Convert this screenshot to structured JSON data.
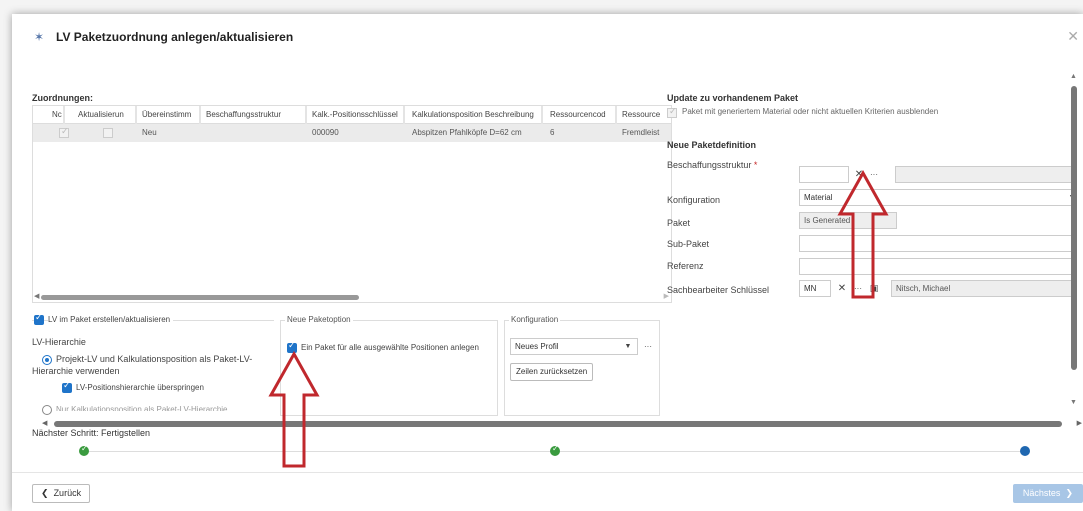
{
  "dialog": {
    "title": "LV Paketzuordnung anlegen/aktualisieren",
    "title_icon": "wand-icon",
    "close_icon": "close-icon"
  },
  "assignments": {
    "label": "Zuordnungen:",
    "columns": [
      "Nc",
      "Aktualisierun",
      "Übereinstimm",
      "Beschaffungsstruktur",
      "Kalk.-Positionsschlüssel",
      "Kalkulationsposition Beschreibung",
      "Ressourcencod",
      "Ressource"
    ],
    "rows": [
      {
        "nc_checked": true,
        "update_checked": false,
        "match": "Neu",
        "procurement": "",
        "calc_key": "000090",
        "calc_desc": "Abspitzen Pfahlköpfe D=62 cm",
        "resource_code": "6",
        "resource": "Fremdleist"
      }
    ]
  },
  "update_pane": {
    "title": "Update zu vorhandenem Paket",
    "hide_label": "Paket mit generiertem Material oder nicht aktuellen Kriterien ausblenden",
    "hide_checked": true
  },
  "new_package": {
    "title": "Neue Paketdefinition",
    "procurement_label": "Beschaffungsstruktur",
    "required_mark": "*",
    "configuration_label": "Konfiguration",
    "configuration_value": "Material",
    "package_label": "Paket",
    "package_value": "Is Generated",
    "subpackage_label": "Sub-Paket",
    "reference_label": "Referenz",
    "clerk_label": "Sachbearbeiter Schlüssel",
    "clerk_key": "MN",
    "clerk_name": "Nitsch, Michael"
  },
  "lv_group": {
    "legend": "LV im Paket erstellen/aktualisieren",
    "legend_checked": true,
    "hierarchy_label": "LV-Hierarchie",
    "radio1_label_line1": "Projekt-LV und Kalkulationsposition als Paket-LV-",
    "radio1_label_line2": "Hierarchie verwenden",
    "skip_label": "LV-Positionshierarchie überspringen",
    "radio2_label": "Nur Kalkulationsposition als Paket-LV-Hierarchie"
  },
  "package_option": {
    "legend": "Neue Paketoption",
    "one_package_label": "Ein Paket für alle ausgewählte Positionen anlegen",
    "one_package_checked": true
  },
  "config_group": {
    "legend": "Konfiguration",
    "profile_value": "Neues Profil",
    "reset_label": "Zeilen zurücksetzen"
  },
  "wizard": {
    "next_step_label": "Nächster Schritt: Fertigstellen",
    "back_label": "Zurück",
    "next_label": "Nächstes",
    "steps": [
      "done",
      "done",
      "current"
    ]
  },
  "colors": {
    "accent": "#1f74c9",
    "done": "#3a9b3f",
    "annotation_arrow": "#c0282d",
    "next_disabled": "#a8c6e6"
  }
}
